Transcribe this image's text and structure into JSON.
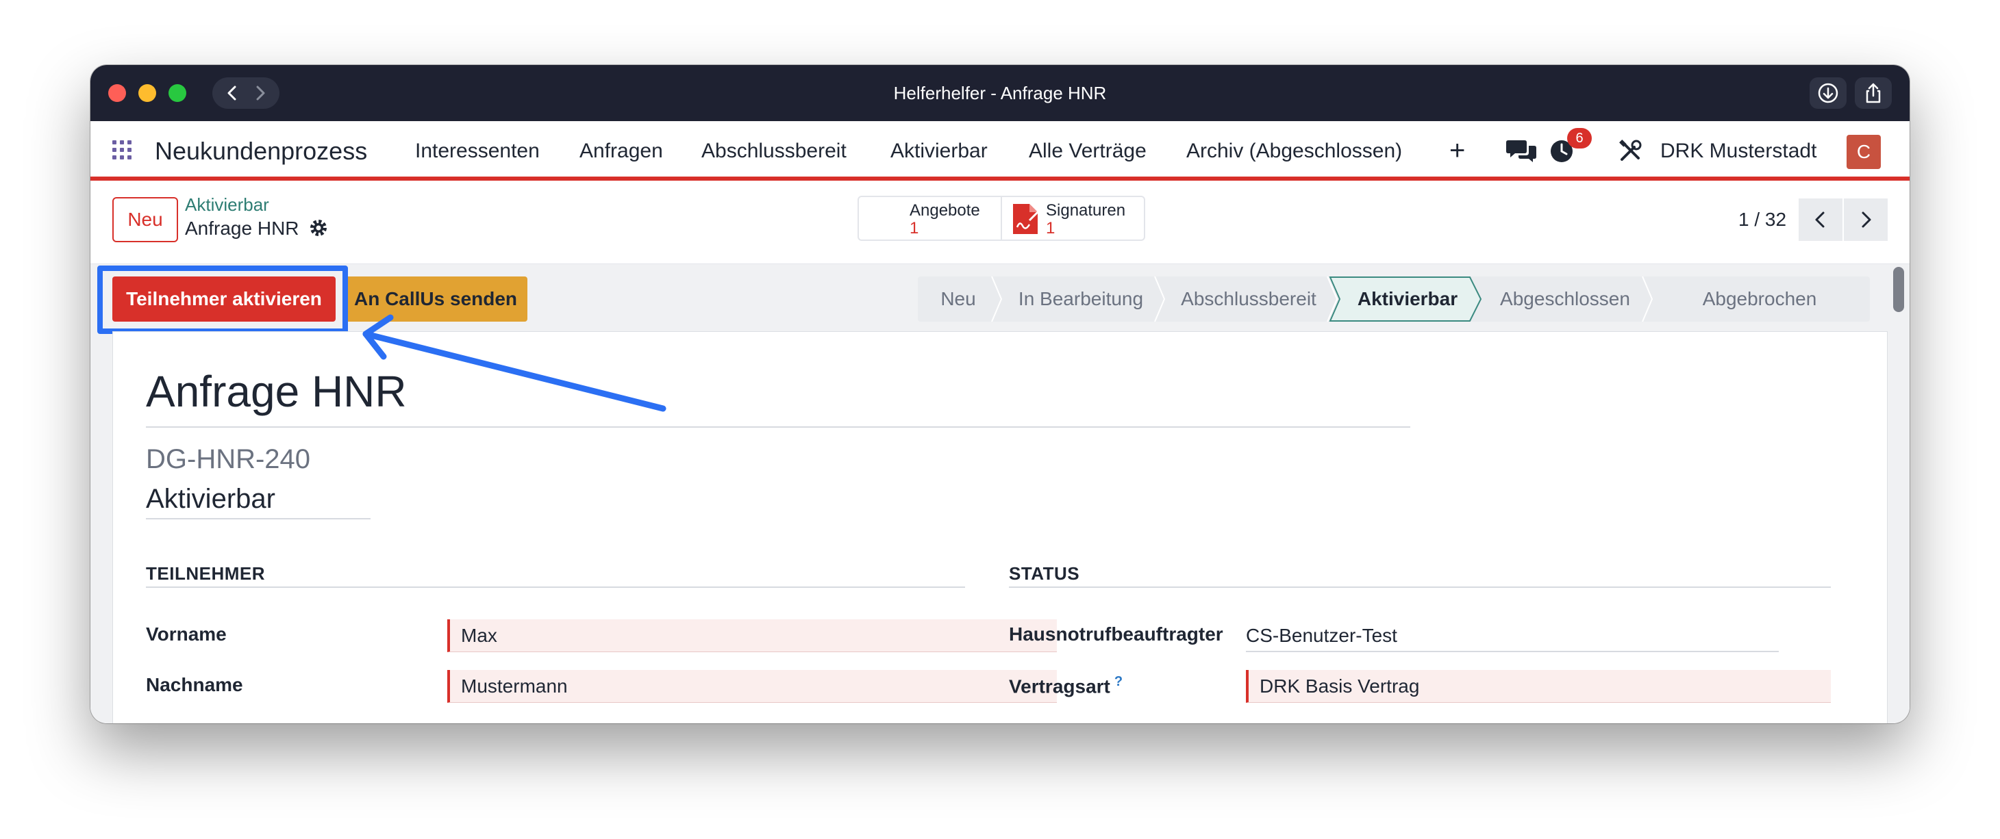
{
  "window": {
    "title": "Helferhelfer - Anfrage HNR"
  },
  "navbar": {
    "brand": "Neukundenprozess",
    "menu": [
      "Interessenten",
      "Anfragen",
      "Abschlussbereit",
      "Aktivierbar",
      "Alle Verträge",
      "Archiv (Abgeschlossen)"
    ],
    "plus": "+",
    "activity_badge": "6",
    "company": "DRK Musterstadt",
    "avatar_letter": "C"
  },
  "control_panel": {
    "new_button": "Neu",
    "breadcrumb_parent": "Aktivierbar",
    "breadcrumb_current": "Anfrage HNR",
    "smart_buttons": [
      {
        "label": "Angebote",
        "count": "1"
      },
      {
        "label": "Signaturen",
        "count": "1"
      }
    ],
    "pager": "1 / 32"
  },
  "statusbar": {
    "buttons": [
      "Teilnehmer aktivieren",
      "An CallUs senden"
    ],
    "stages": [
      "Neu",
      "In Bearbeitung",
      "Abschlussbereit",
      "Aktivierbar",
      "Abgeschlossen",
      "Abgebrochen"
    ],
    "active_stage": "Aktivierbar"
  },
  "form": {
    "title": "Anfrage HNR",
    "reference": "DG-HNR-240",
    "stage": "Aktivierbar",
    "sections": {
      "participant": {
        "title": "TEILNEHMER",
        "fields": [
          {
            "label": "Vorname",
            "value": "Max"
          },
          {
            "label": "Nachname",
            "value": "Mustermann"
          }
        ]
      },
      "status": {
        "title": "STATUS",
        "fields": [
          {
            "label": "Hausnotrufbeauftragter",
            "value": "CS-Benutzer-Test"
          },
          {
            "label": "Vertragsart",
            "help": "?",
            "value": "DRK Basis Vertrag"
          }
        ]
      }
    }
  },
  "colors": {
    "primary_red": "#d8302a",
    "warning_orange": "#e1a232",
    "highlight_blue": "#2b6ff3",
    "breadcrumb_teal": "#2e7d73"
  }
}
